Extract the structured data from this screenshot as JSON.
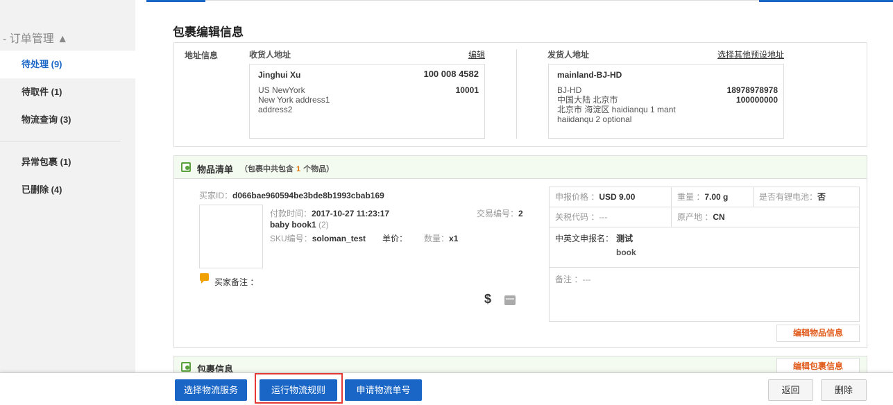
{
  "sidebar": {
    "group_title": "- 订单管理 ▲",
    "items": [
      {
        "label": "待处理 (9)"
      },
      {
        "label": "待取件 (1)"
      },
      {
        "label": "物流查询 (3)"
      },
      {
        "label": "异常包裹 (1)"
      },
      {
        "label": "已删除 (4)"
      }
    ]
  },
  "page": {
    "title": "包裹编辑信息"
  },
  "address": {
    "section_label": "地址信息",
    "recipient": {
      "header": "收货人地址",
      "edit_link": "编辑",
      "name": "Jinghui Xu",
      "phone": "100 008 4582",
      "line1": "US NewYork",
      "line2": "New York address1",
      "line3": "address2",
      "zip": "10001"
    },
    "sender": {
      "header": "发货人地址",
      "choose_link": "选择其他预设地址",
      "name": "mainland-BJ-HD",
      "line1": "BJ-HD",
      "line2": "中国大陆 北京市",
      "line3": "北京市 海淀区 haidianqu 1 mant",
      "line4": "haiidanqu 2 optional",
      "phone": "18978978978",
      "zip": "100000000"
    }
  },
  "items": {
    "title": "物品清单",
    "sub_prefix": "（包裹中共包含",
    "count": "1",
    "sub_suffix": "个物品）",
    "buyer_id_label": "买家ID：",
    "buyer_id": "d066bae960594be3bde8b1993cbab169",
    "pay_time_label": "付款时间：",
    "pay_time": "2017-10-27 11:23:17",
    "trade_no_label": "交易编号：",
    "trade_no": "2",
    "product_name": "baby book1",
    "product_qty_note": "(2)",
    "sku_label": "SKU编号：",
    "sku": "soloman_test",
    "unit_price_label": "单价：",
    "quantity_label": "数量：",
    "quantity": "x1",
    "buyer_note_label": "买家备注 ：",
    "declaration": {
      "price_label": "申报价格 ：",
      "price": "USD 9.00",
      "weight_label": "重量 ：",
      "weight": "7.00 g",
      "battery_label": "是否有锂电池：",
      "battery": "否",
      "customs_label": "关税代码 ：",
      "customs": "---",
      "origin_label": "原产地 ：",
      "origin": "CN",
      "name_label": "中英文申报名：",
      "name_cn": "测试",
      "name_en": "book",
      "remark_label": "备注 ：",
      "remark": "---"
    },
    "edit_button": "编辑物品信息"
  },
  "package": {
    "title": "包裹信息",
    "edit_button": "编辑包裹信息"
  },
  "bottom": {
    "select_service": "选择物流服务",
    "run_rules": "运行物流规则",
    "apply_tracking": "申请物流单号",
    "back": "返回",
    "delete": "删除"
  }
}
